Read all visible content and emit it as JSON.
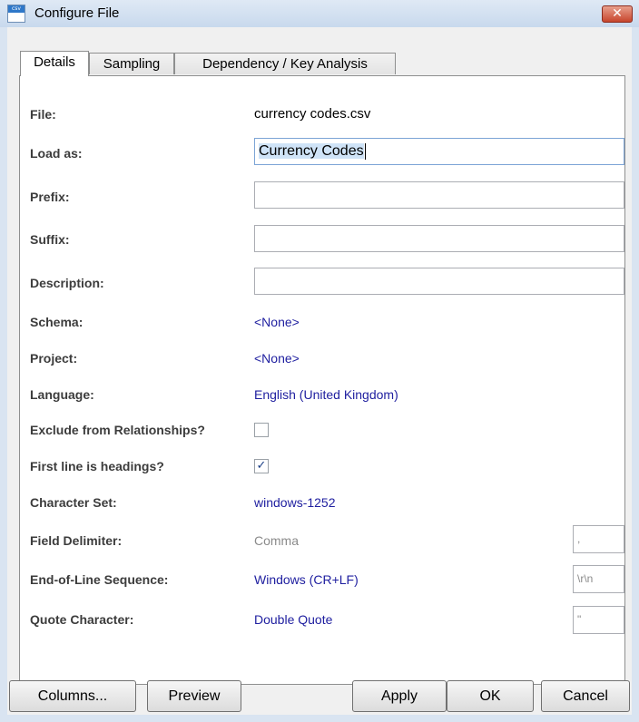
{
  "window": {
    "title": "Configure File",
    "icon": "csv-file-icon",
    "icon_text": "csv",
    "close_glyph": "✕"
  },
  "tabs": [
    {
      "label": "Details",
      "active": true
    },
    {
      "label": "Sampling",
      "active": false
    },
    {
      "label": "Dependency / Key Analysis",
      "active": false
    }
  ],
  "details": {
    "file": {
      "label": "File:",
      "value": "currency codes.csv"
    },
    "load_as": {
      "label": "Load as:",
      "value": "Currency Codes"
    },
    "prefix": {
      "label": "Prefix:",
      "value": ""
    },
    "suffix": {
      "label": "Suffix:",
      "value": ""
    },
    "description": {
      "label": "Description:",
      "value": ""
    },
    "schema": {
      "label": "Schema:",
      "value": "<None>"
    },
    "project": {
      "label": "Project:",
      "value": "<None>"
    },
    "language": {
      "label": "Language:",
      "value": "English (United Kingdom)"
    },
    "exclude": {
      "label": "Exclude from Relationships?",
      "checked": false,
      "check_glyph": ""
    },
    "first_line": {
      "label": "First line is headings?",
      "checked": true,
      "check_glyph": "✓"
    },
    "charset": {
      "label": "Character Set:",
      "value": "windows-1252"
    },
    "field_delim": {
      "label": "Field Delimiter:",
      "value": "Comma",
      "code": ","
    },
    "eol": {
      "label": "End-of-Line Sequence:",
      "value": "Windows (CR+LF)",
      "code": "\\r\\n"
    },
    "quote": {
      "label": "Quote Character:",
      "value": "Double Quote",
      "code": "\""
    }
  },
  "buttons": {
    "columns": "Columns...",
    "preview": "Preview",
    "apply": "Apply",
    "ok": "OK",
    "cancel": "Cancel"
  },
  "colors": {
    "link_value": "#2020a0",
    "label": "#3c3c3c",
    "close": "#c7452c"
  }
}
